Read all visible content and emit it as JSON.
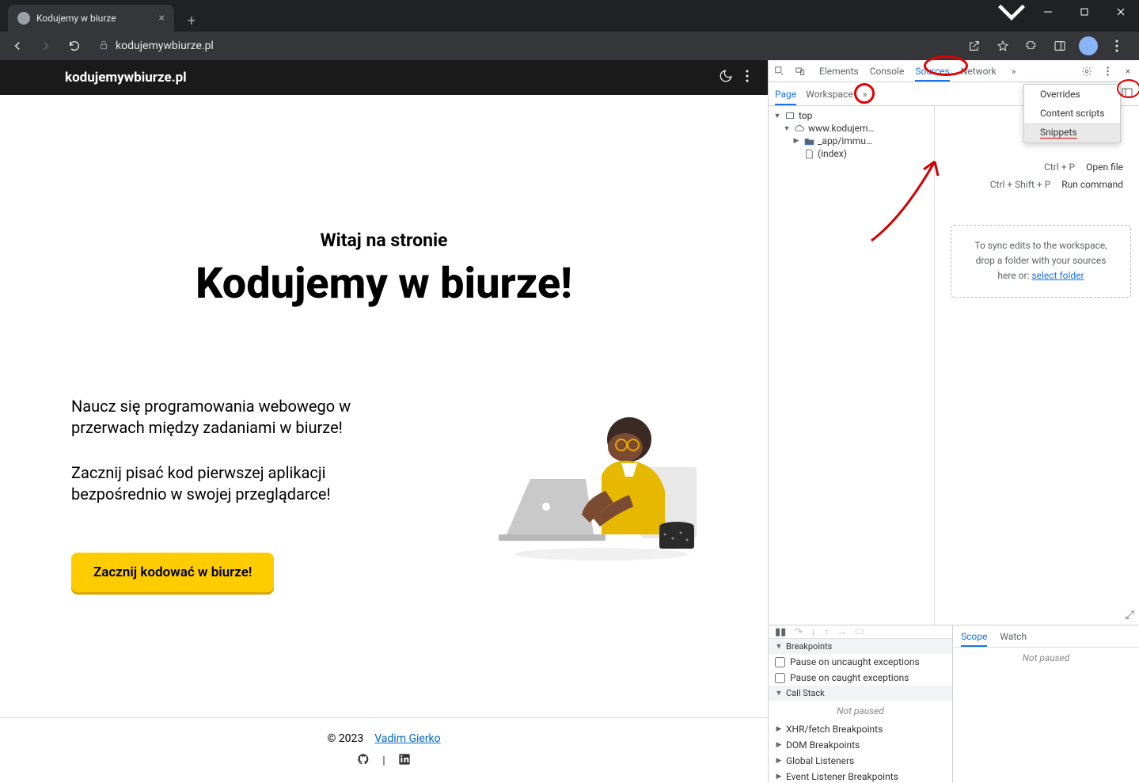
{
  "browser": {
    "tab_title": "Kodujemy w biurze",
    "url": "kodujemywbiurze.pl"
  },
  "page": {
    "brand": "kodujemywbiurze.pl",
    "subtitle": "Witaj na stronie",
    "title": "Kodujemy w biurze!",
    "desc1": "Naucz się programowania webowego w przerwach między zadaniami w biurze!",
    "desc2": "Zacznij pisać kod pierwszej aplikacji bezpośrednio w swojej przeglądarce!",
    "cta": "Zacznij kodować w biurze!",
    "footer_year": "© 2023",
    "footer_author": "Vadim Gierko"
  },
  "devtools": {
    "tabs": [
      "Elements",
      "Console",
      "Sources",
      "Network"
    ],
    "active_tab": "Sources",
    "subtabs": [
      "Page",
      "Workspace"
    ],
    "active_subtab": "Page",
    "tree": {
      "top": "top",
      "domain": "www.kodujem…",
      "folder": "_app/immu…",
      "index": "(index)"
    },
    "dropdown": {
      "overrides": "Overrides",
      "content_scripts": "Content scripts",
      "snippets": "Snippets"
    },
    "hints": {
      "open_shortcut": "Ctrl + P",
      "open_label": "Open file",
      "run_shortcut": "Ctrl + Shift + P",
      "run_label": "Run command"
    },
    "sync_text_1": "To sync edits to the workspace,",
    "sync_text_2": "drop a folder with your sources",
    "sync_text_3": "here or: ",
    "sync_link": "select folder",
    "debugger": {
      "breakpoints": "Breakpoints",
      "pause_uncaught": "Pause on uncaught exceptions",
      "pause_caught": "Pause on caught exceptions",
      "callstack": "Call Stack",
      "not_paused": "Not paused",
      "xhr": "XHR/fetch Breakpoints",
      "dom": "DOM Breakpoints",
      "global": "Global Listeners",
      "event": "Event Listener Breakpoints",
      "scope": "Scope",
      "watch": "Watch",
      "scope_not_paused": "Not paused"
    }
  }
}
